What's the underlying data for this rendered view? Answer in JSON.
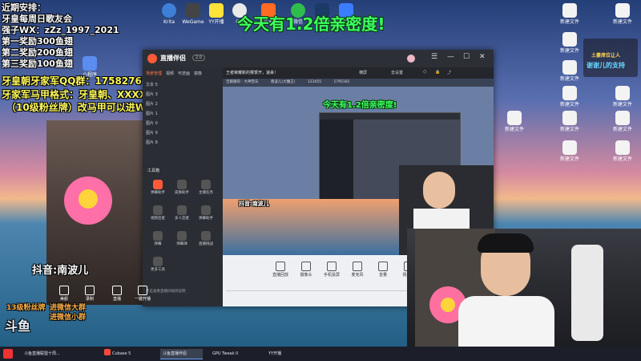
{
  "overlay_left": {
    "lines": [
      "近期安排：",
      "牙皇每周日歌友会",
      "强子WX：zZz_1997_2021",
      "第一奖励300鱼翅",
      "第二奖励200鱼翅",
      "第三奖励100鱼翅"
    ],
    "qq_line": "牙皇朝牙家军QQ群：175827670",
    "format_line": "牙家军马甲格式：牙皇朝、XXXXX",
    "rule_line": "（10级粉丝牌）改马甲可以进WX群",
    "douyin": "抖音:南波儿",
    "fan_promo_1": "13级粉丝牌",
    "fan_promo_2": "进微信大群",
    "fan_promo_3": "进微信小群",
    "platform_logo": "斗鱼"
  },
  "banner": {
    "text": "今天有1.2倍亲密度!"
  },
  "app": {
    "title": "直播伴侣",
    "title_badge": "2.0",
    "notice": "王者荣耀新的赛季开，速来！",
    "toolbar_buttons": [
      "横屏",
      "去设置"
    ],
    "sub_labels": [
      "吉跟随的 - 大神音乐",
      "南波儿(大魔王)"
    ],
    "counts": [
      "123455",
      "1795181"
    ],
    "sidebar_tabs": [
      "场景管理",
      "视频",
      "可迭画",
      "镜像"
    ],
    "scenes": [
      "文本 5",
      "图片 3",
      "图片 2",
      "图片 1",
      "图片 0",
      "图片 9",
      "图片 8"
    ],
    "tools_title": "工具箱",
    "tools": [
      "弹幕助手",
      "皮肤助手",
      "主播任务",
      "视频连麦",
      "多人连麦",
      "弹幕助手",
      "弹幕",
      "弹幕球",
      "直播挑战",
      "更多工具"
    ],
    "bottom_buttons": [
      "直播回放",
      "摄像头",
      "手机投屏",
      "麦克风",
      "音量",
      "扬声器"
    ],
    "left_bottom_buttons": [
      "美颜",
      "录制",
      "直播",
      "一键开播"
    ],
    "chat_footer": "点击查看直播间规则说明"
  },
  "camera_overlay": {
    "line1": "土豪席位让人",
    "line2": "谢谢儿的支持"
  },
  "desktop_icons": [
    {
      "label": "Krita",
      "color": "#3e7fd8"
    },
    {
      "label": "WeGame",
      "color": "#444"
    },
    {
      "label": "YY开播",
      "color": "#ffe23a"
    },
    {
      "label": "QQ",
      "color": "#e9e9e9"
    },
    {
      "label": "斗鱼",
      "color": "#ff6b23"
    },
    {
      "label": "微信",
      "color": "#2fbe4c"
    },
    {
      "label": "Steam",
      "color": "#1b3a66"
    },
    {
      "label": "腾讯会议",
      "color": "#3a7dff"
    },
    {
      "label": "小程序",
      "color": "#5b8def"
    }
  ],
  "right_icons": [
    "新建文件",
    "新建文件",
    "新建文件",
    "新建文件",
    "新建文件",
    "新建文件",
    "新建文件",
    "新建文件",
    "新建文件",
    "新建文件",
    "新建文件"
  ],
  "taskbar": {
    "items": [
      "斗鱼直播联盟十周...",
      "斗鱼直播伴侣",
      "Cubase 5",
      "斗鱼直播伴侣",
      "GPU Tweak II",
      "YY开播"
    ],
    "active_index": 3
  },
  "colors": {
    "overlay_green": "#3dff62",
    "overlay_yellow": "#fff95a",
    "app_dark": "#2a2d33",
    "accent_red": "#ff4a3d"
  }
}
